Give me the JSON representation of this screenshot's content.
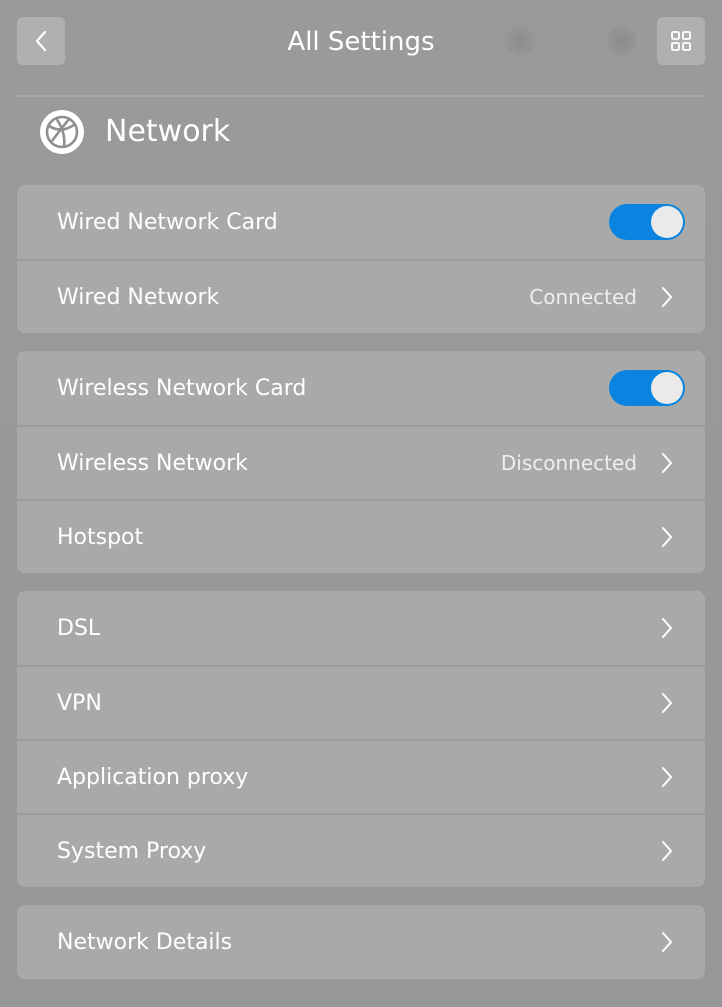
{
  "titlebar": {
    "title": "All Settings"
  },
  "section": {
    "title": "Network"
  },
  "groups": {
    "wired": {
      "card_label": "Wired Network Card",
      "card_enabled": true,
      "network_label": "Wired Network",
      "network_status": "Connected"
    },
    "wireless": {
      "card_label": "Wireless Network Card",
      "card_enabled": true,
      "network_label": "Wireless Network",
      "network_status": "Disconnected",
      "hotspot_label": "Hotspot"
    },
    "other": {
      "dsl_label": "DSL",
      "vpn_label": "VPN",
      "app_proxy_label": "Application proxy",
      "system_proxy_label": "System Proxy"
    },
    "details": {
      "label": "Network Details"
    }
  },
  "icons": {
    "back": "chevron-left-icon",
    "grid": "grid-icon",
    "network": "globe-icon",
    "chevron": "chevron-right-icon"
  },
  "colors": {
    "toggle_on": "#0a84e0",
    "background": "#999999",
    "card": "#a9a9a9"
  }
}
